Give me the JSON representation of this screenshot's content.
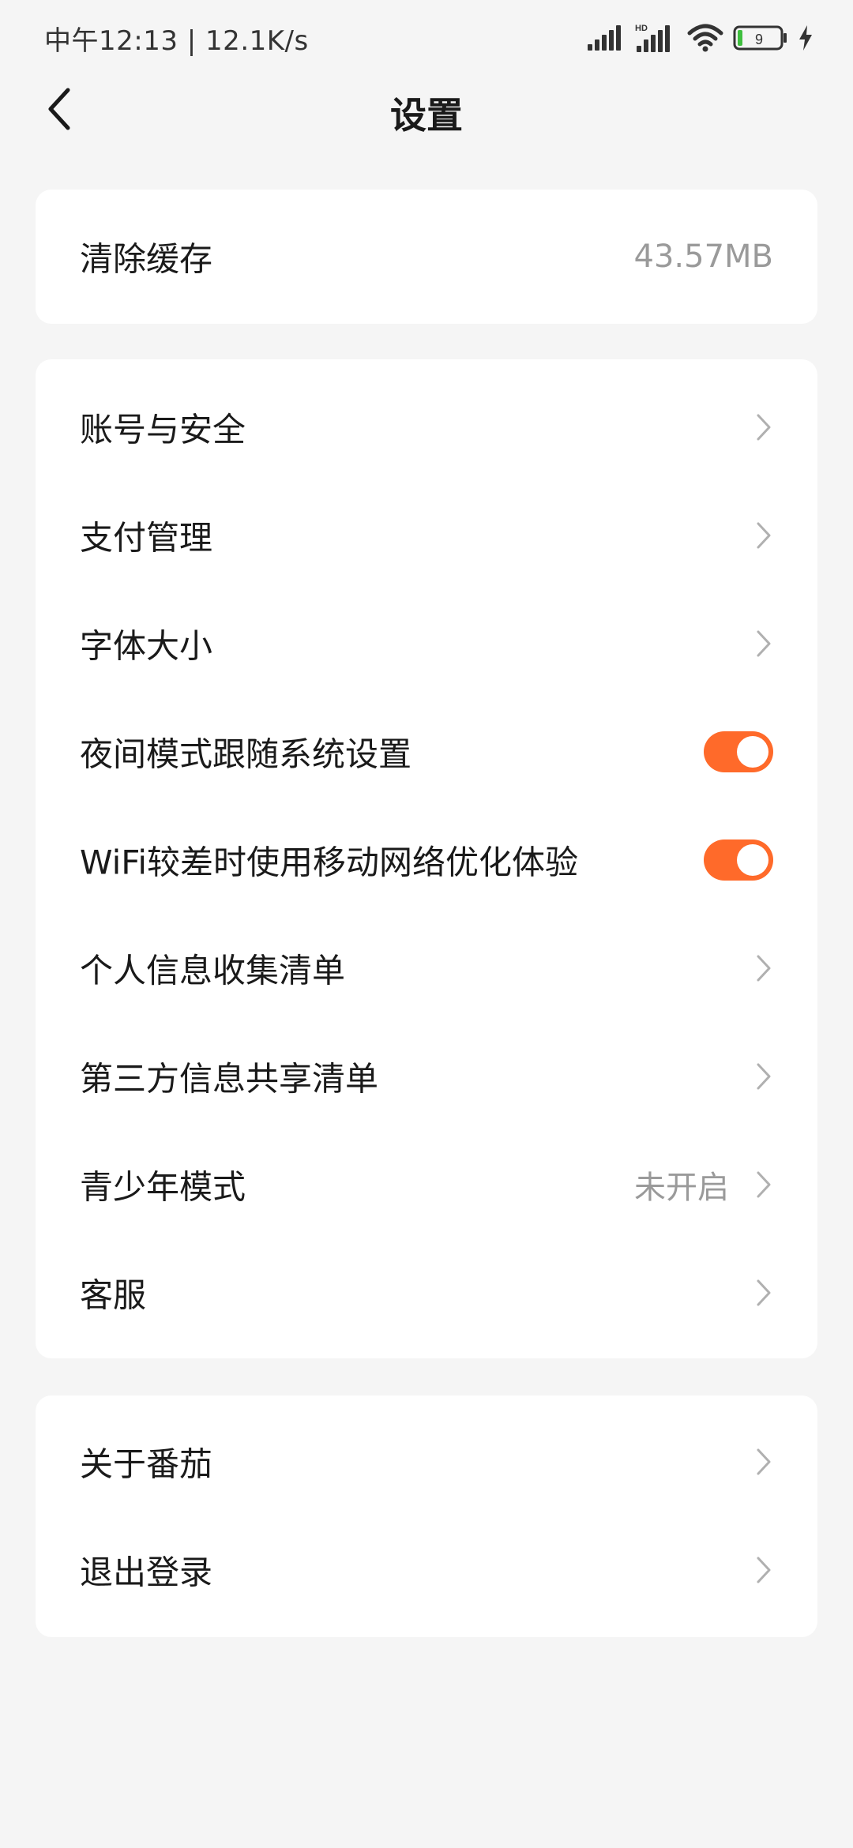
{
  "status_bar": {
    "left_text": "中午12:13 | 12.1K/s",
    "signal_label": "HD",
    "battery_level": "9"
  },
  "header": {
    "title": "设置"
  },
  "cache": {
    "label": "清除缓存",
    "value": "43.57MB"
  },
  "settings": [
    {
      "label": "账号与安全",
      "type": "link"
    },
    {
      "label": "支付管理",
      "type": "link"
    },
    {
      "label": "字体大小",
      "type": "link"
    },
    {
      "label": "夜间模式跟随系统设置",
      "type": "toggle",
      "on": true
    },
    {
      "label": "WiFi较差时使用移动网络优化体验",
      "type": "toggle",
      "on": true
    },
    {
      "label": "个人信息收集清单",
      "type": "link"
    },
    {
      "label": "第三方信息共享清单",
      "type": "link"
    },
    {
      "label": "青少年模式",
      "type": "link",
      "value": "未开启"
    },
    {
      "label": "客服",
      "type": "link"
    }
  ],
  "about": [
    {
      "label": "关于番茄",
      "type": "link"
    },
    {
      "label": "退出登录",
      "type": "link"
    }
  ],
  "colors": {
    "accent": "#ff6a2a",
    "background": "#f5f5f5",
    "card": "#ffffff",
    "secondary_text": "#9a9a9a"
  }
}
